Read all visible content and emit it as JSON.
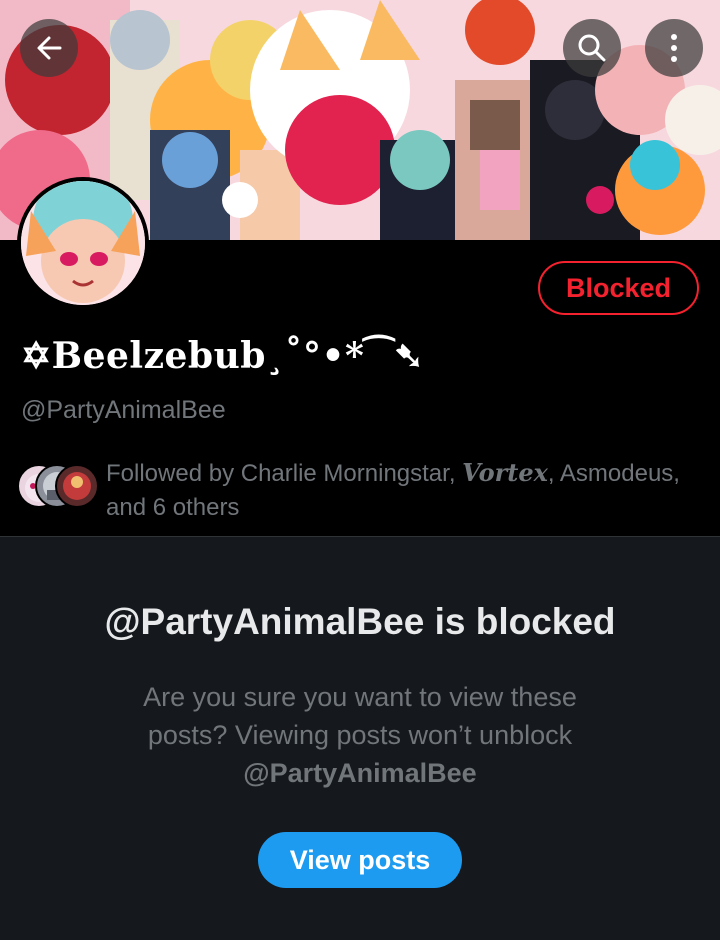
{
  "header": {
    "back_icon": "arrow-left-icon",
    "search_icon": "search-icon",
    "more_icon": "more-vertical-icon"
  },
  "profile": {
    "display_name": "✡Beelzebub¸˚°•*⁀➷",
    "handle": "@PartyAnimalBee",
    "relationship_button": "Blocked",
    "followed_by": {
      "prefix": "Followed by Charlie Morningstar, ",
      "vortex": "Vortex",
      "suffix": ", Asmodeus, and 6 others"
    }
  },
  "blocked_notice": {
    "title": "@PartyAnimalBee is blocked",
    "description": "Are you sure you want to view these posts? Viewing posts won’t unblock",
    "description_handle": "@PartyAnimalBee",
    "view_button": "View posts"
  },
  "colors": {
    "blocked_red": "#f4212e",
    "accent_blue": "#1d9bf0",
    "secondary_text": "#71767b",
    "panel_bg": "#15181c"
  }
}
